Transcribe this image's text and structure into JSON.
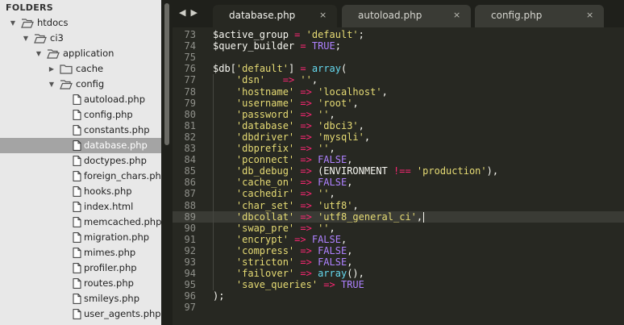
{
  "sidebar": {
    "header": "FOLDERS",
    "items": [
      {
        "label": "htdocs",
        "type": "folder",
        "open": true,
        "depth": 0
      },
      {
        "label": "ci3",
        "type": "folder",
        "open": true,
        "depth": 1
      },
      {
        "label": "application",
        "type": "folder",
        "open": true,
        "depth": 2
      },
      {
        "label": "cache",
        "type": "folder",
        "open": false,
        "depth": 3
      },
      {
        "label": "config",
        "type": "folder",
        "open": true,
        "depth": 3
      },
      {
        "label": "autoload.php",
        "type": "file",
        "depth": 4
      },
      {
        "label": "config.php",
        "type": "file",
        "depth": 4
      },
      {
        "label": "constants.php",
        "type": "file",
        "depth": 4
      },
      {
        "label": "database.php",
        "type": "file",
        "depth": 4,
        "selected": true
      },
      {
        "label": "doctypes.php",
        "type": "file",
        "depth": 4
      },
      {
        "label": "foreign_chars.php",
        "type": "file",
        "depth": 4
      },
      {
        "label": "hooks.php",
        "type": "file",
        "depth": 4
      },
      {
        "label": "index.html",
        "type": "file",
        "depth": 4
      },
      {
        "label": "memcached.php",
        "type": "file",
        "depth": 4
      },
      {
        "label": "migration.php",
        "type": "file",
        "depth": 4
      },
      {
        "label": "mimes.php",
        "type": "file",
        "depth": 4
      },
      {
        "label": "profiler.php",
        "type": "file",
        "depth": 4
      },
      {
        "label": "routes.php",
        "type": "file",
        "depth": 4
      },
      {
        "label": "smileys.php",
        "type": "file",
        "depth": 4
      },
      {
        "label": "user_agents.php",
        "type": "file",
        "depth": 4
      }
    ]
  },
  "tabs": [
    {
      "label": "database.php",
      "active": true
    },
    {
      "label": "autoload.php",
      "active": false
    },
    {
      "label": "config.php",
      "active": false
    }
  ],
  "tab_close_glyph": "×",
  "nav": {
    "left": "◀",
    "right": "▶"
  },
  "editor": {
    "current_line": 89,
    "lines": [
      {
        "n": "73",
        "t": [
          [
            "v",
            "$active_group"
          ],
          [
            "p",
            " "
          ],
          [
            "o",
            "="
          ],
          [
            "p",
            " "
          ],
          [
            "s",
            "'default'"
          ],
          [
            "p",
            ";"
          ]
        ]
      },
      {
        "n": "74",
        "t": [
          [
            "v",
            "$query_builder"
          ],
          [
            "p",
            " "
          ],
          [
            "o",
            "="
          ],
          [
            "p",
            " "
          ],
          [
            "c",
            "TRUE"
          ],
          [
            "p",
            ";"
          ]
        ]
      },
      {
        "n": "75",
        "t": []
      },
      {
        "n": "76",
        "t": [
          [
            "v",
            "$db"
          ],
          [
            "p",
            "["
          ],
          [
            "s",
            "'default'"
          ],
          [
            "p",
            "] "
          ],
          [
            "o",
            "="
          ],
          [
            "p",
            " "
          ],
          [
            "f",
            "array"
          ],
          [
            "p",
            "("
          ]
        ]
      },
      {
        "n": "77",
        "t": [
          [
            "p",
            "    "
          ],
          [
            "s",
            "'dsn'"
          ],
          [
            "p",
            "   "
          ],
          [
            "o",
            "=>"
          ],
          [
            "p",
            " "
          ],
          [
            "s",
            "''"
          ],
          [
            "p",
            ","
          ]
        ]
      },
      {
        "n": "78",
        "t": [
          [
            "p",
            "    "
          ],
          [
            "s",
            "'hostname'"
          ],
          [
            "p",
            " "
          ],
          [
            "o",
            "=>"
          ],
          [
            "p",
            " "
          ],
          [
            "s",
            "'localhost'"
          ],
          [
            "p",
            ","
          ]
        ]
      },
      {
        "n": "79",
        "t": [
          [
            "p",
            "    "
          ],
          [
            "s",
            "'username'"
          ],
          [
            "p",
            " "
          ],
          [
            "o",
            "=>"
          ],
          [
            "p",
            " "
          ],
          [
            "s",
            "'root'"
          ],
          [
            "p",
            ","
          ]
        ]
      },
      {
        "n": "80",
        "t": [
          [
            "p",
            "    "
          ],
          [
            "s",
            "'password'"
          ],
          [
            "p",
            " "
          ],
          [
            "o",
            "=>"
          ],
          [
            "p",
            " "
          ],
          [
            "s",
            "''"
          ],
          [
            "p",
            ","
          ]
        ]
      },
      {
        "n": "81",
        "t": [
          [
            "p",
            "    "
          ],
          [
            "s",
            "'database'"
          ],
          [
            "p",
            " "
          ],
          [
            "o",
            "=>"
          ],
          [
            "p",
            " "
          ],
          [
            "s",
            "'dbci3'"
          ],
          [
            "p",
            ","
          ]
        ]
      },
      {
        "n": "82",
        "t": [
          [
            "p",
            "    "
          ],
          [
            "s",
            "'dbdriver'"
          ],
          [
            "p",
            " "
          ],
          [
            "o",
            "=>"
          ],
          [
            "p",
            " "
          ],
          [
            "s",
            "'mysqli'"
          ],
          [
            "p",
            ","
          ]
        ]
      },
      {
        "n": "83",
        "t": [
          [
            "p",
            "    "
          ],
          [
            "s",
            "'dbprefix'"
          ],
          [
            "p",
            " "
          ],
          [
            "o",
            "=>"
          ],
          [
            "p",
            " "
          ],
          [
            "s",
            "''"
          ],
          [
            "p",
            ","
          ]
        ]
      },
      {
        "n": "84",
        "t": [
          [
            "p",
            "    "
          ],
          [
            "s",
            "'pconnect'"
          ],
          [
            "p",
            " "
          ],
          [
            "o",
            "=>"
          ],
          [
            "p",
            " "
          ],
          [
            "c",
            "FALSE"
          ],
          [
            "p",
            ","
          ]
        ]
      },
      {
        "n": "85",
        "t": [
          [
            "p",
            "    "
          ],
          [
            "s",
            "'db_debug'"
          ],
          [
            "p",
            " "
          ],
          [
            "o",
            "=>"
          ],
          [
            "p",
            " (ENVIRONMENT "
          ],
          [
            "o",
            "!=="
          ],
          [
            "p",
            " "
          ],
          [
            "s",
            "'production'"
          ],
          [
            "p",
            "),"
          ]
        ]
      },
      {
        "n": "86",
        "t": [
          [
            "p",
            "    "
          ],
          [
            "s",
            "'cache_on'"
          ],
          [
            "p",
            " "
          ],
          [
            "o",
            "=>"
          ],
          [
            "p",
            " "
          ],
          [
            "c",
            "FALSE"
          ],
          [
            "p",
            ","
          ]
        ]
      },
      {
        "n": "87",
        "t": [
          [
            "p",
            "    "
          ],
          [
            "s",
            "'cachedir'"
          ],
          [
            "p",
            " "
          ],
          [
            "o",
            "=>"
          ],
          [
            "p",
            " "
          ],
          [
            "s",
            "''"
          ],
          [
            "p",
            ","
          ]
        ]
      },
      {
        "n": "88",
        "t": [
          [
            "p",
            "    "
          ],
          [
            "s",
            "'char_set'"
          ],
          [
            "p",
            " "
          ],
          [
            "o",
            "=>"
          ],
          [
            "p",
            " "
          ],
          [
            "s",
            "'utf8'"
          ],
          [
            "p",
            ","
          ]
        ]
      },
      {
        "n": "89",
        "t": [
          [
            "p",
            "    "
          ],
          [
            "s",
            "'dbcollat'"
          ],
          [
            "p",
            " "
          ],
          [
            "o",
            "=>"
          ],
          [
            "p",
            " "
          ],
          [
            "s",
            "'utf8_general_ci'"
          ],
          [
            "p",
            ","
          ]
        ]
      },
      {
        "n": "90",
        "t": [
          [
            "p",
            "    "
          ],
          [
            "s",
            "'swap_pre'"
          ],
          [
            "p",
            " "
          ],
          [
            "o",
            "=>"
          ],
          [
            "p",
            " "
          ],
          [
            "s",
            "''"
          ],
          [
            "p",
            ","
          ]
        ]
      },
      {
        "n": "91",
        "t": [
          [
            "p",
            "    "
          ],
          [
            "s",
            "'encrypt'"
          ],
          [
            "p",
            " "
          ],
          [
            "o",
            "=>"
          ],
          [
            "p",
            " "
          ],
          [
            "c",
            "FALSE"
          ],
          [
            "p",
            ","
          ]
        ]
      },
      {
        "n": "92",
        "t": [
          [
            "p",
            "    "
          ],
          [
            "s",
            "'compress'"
          ],
          [
            "p",
            " "
          ],
          [
            "o",
            "=>"
          ],
          [
            "p",
            " "
          ],
          [
            "c",
            "FALSE"
          ],
          [
            "p",
            ","
          ]
        ]
      },
      {
        "n": "93",
        "t": [
          [
            "p",
            "    "
          ],
          [
            "s",
            "'stricton'"
          ],
          [
            "p",
            " "
          ],
          [
            "o",
            "=>"
          ],
          [
            "p",
            " "
          ],
          [
            "c",
            "FALSE"
          ],
          [
            "p",
            ","
          ]
        ]
      },
      {
        "n": "94",
        "t": [
          [
            "p",
            "    "
          ],
          [
            "s",
            "'failover'"
          ],
          [
            "p",
            " "
          ],
          [
            "o",
            "=>"
          ],
          [
            "p",
            " "
          ],
          [
            "f",
            "array"
          ],
          [
            "p",
            "(),"
          ]
        ]
      },
      {
        "n": "95",
        "t": [
          [
            "p",
            "    "
          ],
          [
            "s",
            "'save_queries'"
          ],
          [
            "p",
            " "
          ],
          [
            "o",
            "=>"
          ],
          [
            "p",
            " "
          ],
          [
            "c",
            "TRUE"
          ]
        ]
      },
      {
        "n": "96",
        "t": [
          [
            "p",
            ");"
          ]
        ]
      },
      {
        "n": "97",
        "t": []
      }
    ]
  },
  "colors": {
    "string": "#e6db74",
    "operator": "#f92672",
    "constant": "#ae81ff",
    "function": "#66d9ef",
    "background": "#272822"
  }
}
